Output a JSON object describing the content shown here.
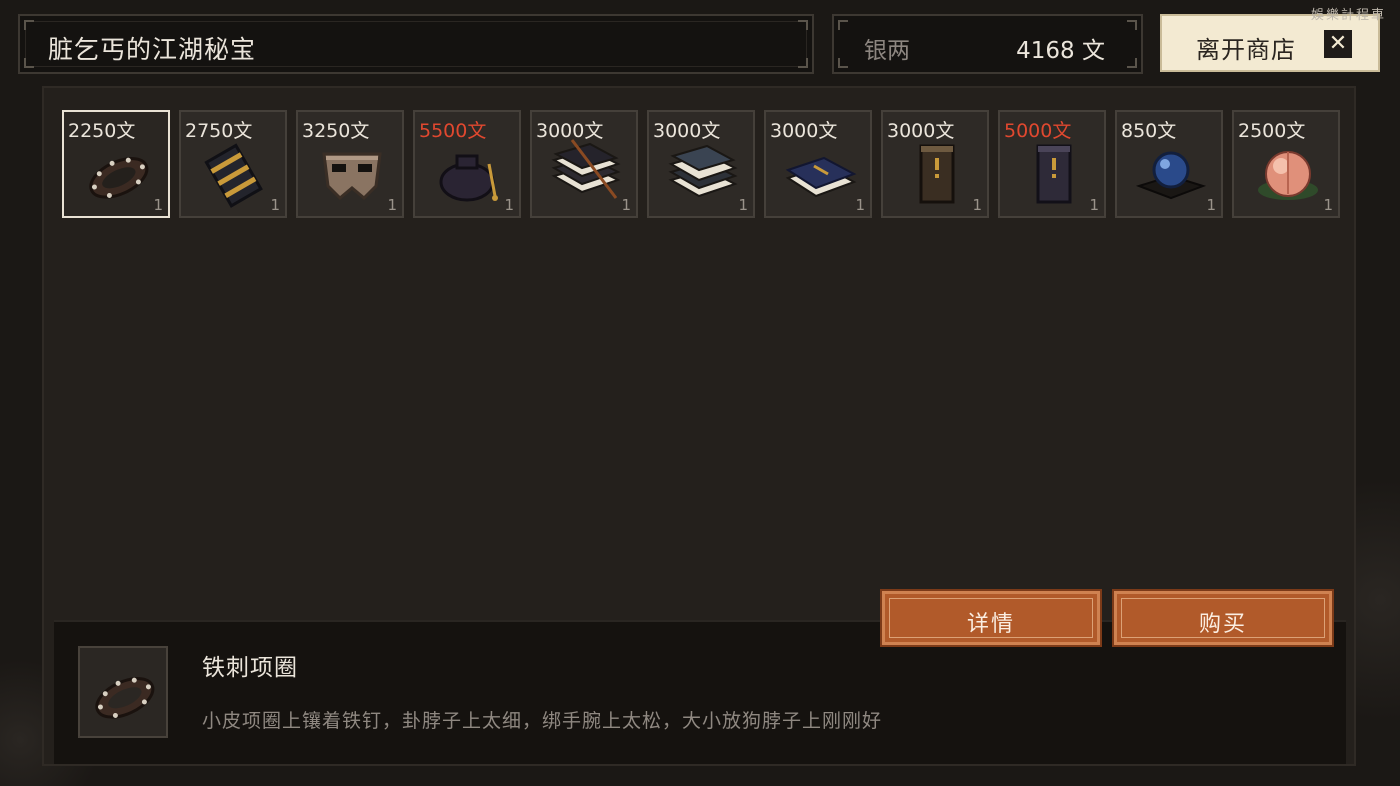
{
  "shop": {
    "title": "脏乞丐的江湖秘宝",
    "money_label": "银两",
    "money_value": "4168 文",
    "leave_label": "离开商店",
    "close_glyph": "✕",
    "watermark": "娛樂計程車"
  },
  "items": [
    {
      "price": "2250文",
      "qty": "1",
      "price_color": "#ebe5db",
      "icon": "spiked-collar-icon",
      "selected": true
    },
    {
      "price": "2750文",
      "qty": "1",
      "price_color": "#ebe5db",
      "icon": "bracer-icon"
    },
    {
      "price": "3250文",
      "qty": "1",
      "price_color": "#ebe5db",
      "icon": "mask-icon"
    },
    {
      "price": "5500文",
      "qty": "1",
      "price_color": "#e0482f",
      "icon": "pouch-icon"
    },
    {
      "price": "3000文",
      "qty": "1",
      "price_color": "#ebe5db",
      "icon": "book-stack-brush-icon"
    },
    {
      "price": "3000文",
      "qty": "1",
      "price_color": "#ebe5db",
      "icon": "book-stack-icon"
    },
    {
      "price": "3000文",
      "qty": "1",
      "price_color": "#ebe5db",
      "icon": "blue-book-icon"
    },
    {
      "price": "3000文",
      "qty": "1",
      "price_color": "#ebe5db",
      "icon": "scroll-icon"
    },
    {
      "price": "5000文",
      "qty": "1",
      "price_color": "#e0482f",
      "icon": "dark-scroll-icon"
    },
    {
      "price": "850文",
      "qty": "1",
      "price_color": "#ebe5db",
      "icon": "crystal-orb-icon"
    },
    {
      "price": "2500文",
      "qty": "1",
      "price_color": "#ebe5db",
      "icon": "peach-icon"
    }
  ],
  "buttons": {
    "details_label": "详情",
    "buy_label": "购买"
  },
  "description": {
    "name": "铁刺项圈",
    "text": "小皮项圈上镶着铁钉，卦脖子上太细，绑手腕上太松，大小放狗脖子上刚刚好",
    "icon": "spiked-collar-icon"
  }
}
